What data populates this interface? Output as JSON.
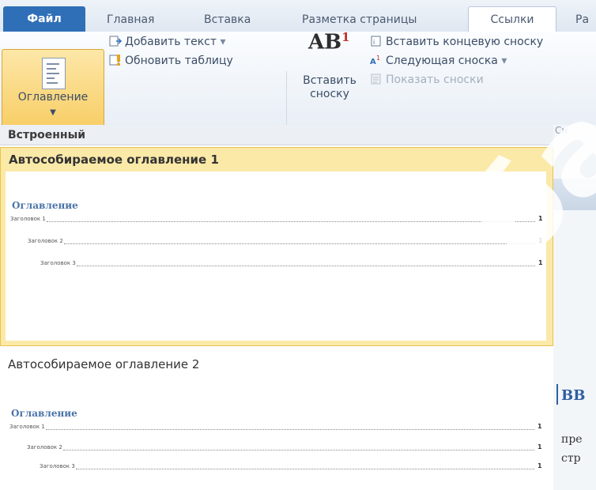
{
  "tabs": [
    "Файл",
    "Главная",
    "Вставка",
    "Разметка страницы",
    "Ссылки",
    "Ра"
  ],
  "ribbon": {
    "toc_label": "Оглавление",
    "add_text": "Добавить текст",
    "update_table": "Обновить таблицу",
    "insert_endnote": "Вставить концевую сноску",
    "next_footnote": "Следующая сноска",
    "show_notes": "Показать сноски",
    "insert_footnote_line1": "Вставить",
    "insert_footnote_line2": "сноску",
    "ab_text": "AB",
    "ab_sup": "1",
    "group_cut": "Сн"
  },
  "dropdown": {
    "section_header": "Встроенный",
    "items": [
      {
        "title": "Автособираемое оглавление 1",
        "preview_title": "Оглавление",
        "lines": [
          "Заголовок 1",
          "Заголовок 2",
          "Заголовок 3"
        ],
        "page": "1"
      },
      {
        "title": "Автособираемое оглавление 2",
        "preview_title": "Оглавление",
        "lines": [
          "Заголовок 1",
          "Заголовок 2",
          "Заголовок 3"
        ],
        "page": "1"
      }
    ]
  },
  "document": {
    "heading_fragment": "ВВ",
    "line1_fragment": "пре",
    "line2_fragment": "стр"
  },
  "watermark": "база",
  "colors": {
    "file_tab": "#2f6fb7",
    "hover_item": "#fbe9a8",
    "toc_heading": "#4a73a8"
  }
}
